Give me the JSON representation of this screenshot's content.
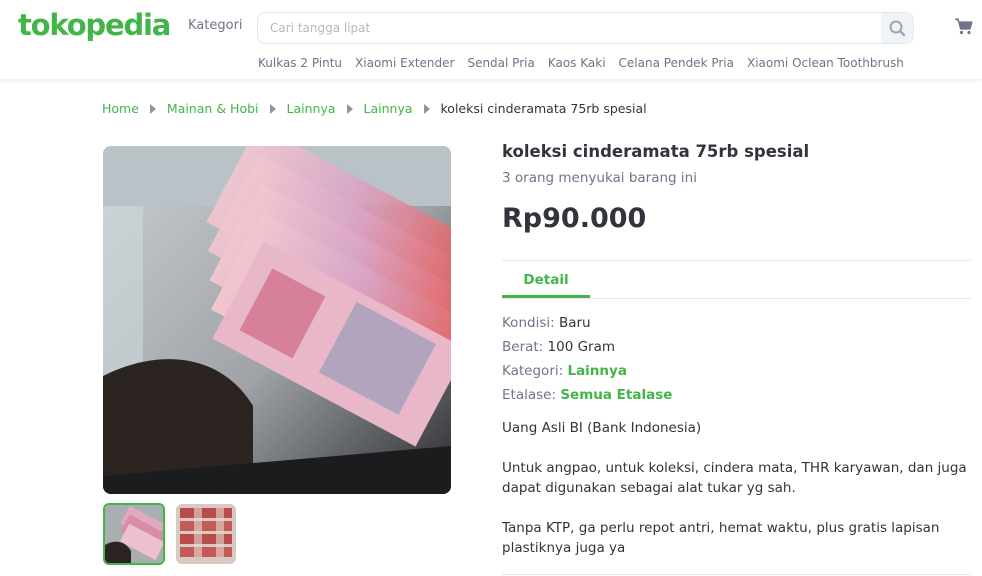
{
  "header": {
    "logo": "tokopedia",
    "category_label": "Kategori",
    "search_placeholder": "Cari tangga lipat",
    "suggestions": [
      "Kulkas 2 Pintu",
      "Xiaomi Extender",
      "Sendal Pria",
      "Kaos Kaki",
      "Celana Pendek Pria",
      "Xiaomi Oclean Toothbrush"
    ]
  },
  "breadcrumb": [
    "Home",
    "Mainan & Hobi",
    "Lainnya",
    "Lainnya",
    "koleksi cinderamata 75rb spesial"
  ],
  "product": {
    "title": "koleksi cinderamata 75rb spesial",
    "likes": "3 orang menyukai barang ini",
    "price": "Rp90.000",
    "tab": "Detail",
    "specs": [
      {
        "label": "Kondisi:",
        "value": "Baru"
      },
      {
        "label": "Berat:",
        "value": "100 Gram"
      },
      {
        "label": "Kategori:",
        "value": "Lainnya"
      },
      {
        "label": "Etalase:",
        "value": "Semua Etalase"
      }
    ],
    "description": [
      "Uang Asli BI (Bank Indonesia)",
      "Untuk angpao, untuk koleksi, cindera mata, THR karyawan, dan juga dapat digunakan sebagai alat tukar yg sah.",
      "Tanpa KTP, ga perlu repot antri, hemat waktu, plus gratis lapisan plastiknya juga ya"
    ]
  },
  "icons": {
    "search": "search-icon",
    "cart": "cart-icon",
    "breadcrumb_separator": "chevron-right-icon"
  },
  "colors": {
    "brand_green": "#42b549",
    "text": "#31353b",
    "muted": "#6d7588"
  }
}
